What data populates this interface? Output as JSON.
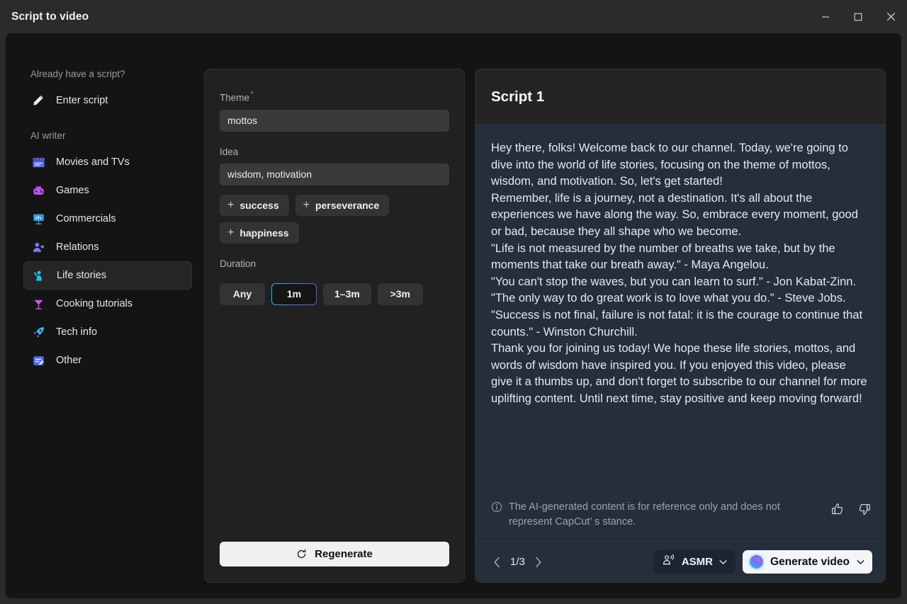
{
  "window": {
    "title": "Script to video",
    "controls": {
      "minimize": "minimize-button",
      "maximize": "maximize-button",
      "close": "close-button"
    }
  },
  "sidebar": {
    "groups": [
      {
        "label": "Already have a script?",
        "items": [
          {
            "label": "Enter script",
            "icon": "pencil-icon",
            "selected": false
          }
        ]
      },
      {
        "label": "AI writer",
        "items": [
          {
            "label": "Movies and TVs",
            "icon": "clapperboard-icon",
            "selected": false
          },
          {
            "label": "Games",
            "icon": "gamepad-icon",
            "selected": false
          },
          {
            "label": "Commercials",
            "icon": "presentation-chart-icon",
            "selected": false
          },
          {
            "label": "Relations",
            "icon": "person-heart-icon",
            "selected": false
          },
          {
            "label": "Life stories",
            "icon": "person-waving-icon",
            "selected": true
          },
          {
            "label": "Cooking tutorials",
            "icon": "cocktail-glass-icon",
            "selected": false
          },
          {
            "label": "Tech info",
            "icon": "rocket-icon",
            "selected": false
          },
          {
            "label": "Other",
            "icon": "note-edit-icon",
            "selected": false
          }
        ]
      }
    ]
  },
  "form": {
    "theme_label": "Theme",
    "theme_required_marker": "*",
    "theme_value": "mottos",
    "theme_placeholder": "mottos",
    "idea_label": "Idea",
    "idea_value": "wisdom, motivation",
    "idea_placeholder": "wisdom, motivation",
    "suggestion_chips": [
      {
        "plus": "+",
        "label": "success"
      },
      {
        "plus": "+",
        "label": "perseverance"
      },
      {
        "plus": "+",
        "label": "happiness"
      }
    ],
    "duration_label": "Duration",
    "duration_options": [
      {
        "label": "Any",
        "active": false
      },
      {
        "label": "1m",
        "active": true
      },
      {
        "label": "1–3m",
        "active": false
      },
      {
        "label": ">3m",
        "active": false
      }
    ],
    "regenerate_label": "Regenerate",
    "regenerate_icon": "refresh-icon"
  },
  "script_panel": {
    "title": "Script 1",
    "body": "Hey there, folks! Welcome back to our channel. Today, we're going to dive into the world of life stories, focusing on the theme of mottos, wisdom, and motivation. So, let's get started!\nRemember, life is a journey, not a destination. It's all about the experiences we have along the way. So, embrace every moment, good or bad, because they all shape who we become.\n\"Life is not measured by the number of breaths we take, but by the moments that take our breath away.\" - Maya Angelou.\n\"You can't stop the waves, but you can learn to surf.\" - Jon Kabat-Zinn.\n\"The only way to do great work is to love what you do.\" - Steve Jobs.\n\"Success is not final, failure is not fatal: it is the courage to continue that counts.\" - Winston Churchill.\nThank you for joining us today! We hope these life stories, mottos, and words of wisdom have inspired you. If you enjoyed this video, please give it a thumbs up, and don't forget to subscribe to our channel for more uplifting content. Until next time, stay positive and keep moving forward!",
    "disclaimer": "The AI-generated content is for reference only and does not represent CapCut’ s stance.",
    "disclaimer_icon": "info-circle-icon",
    "thumbs_up_icon": "thumbs-up-icon",
    "thumbs_down_icon": "thumbs-down-icon",
    "pagination": {
      "prev_icon": "chevron-left-icon",
      "label": "1/3",
      "next_icon": "chevron-right-icon"
    },
    "asmr": {
      "icon": "voice-person-icon",
      "label": "ASMR",
      "caret": "chevron-down-icon"
    },
    "generate": {
      "icon": "ai-orb-icon",
      "label": "Generate video",
      "caret": "chevron-down-icon"
    }
  },
  "colors": {
    "app_background": "#141414",
    "titlebar": "#2b2b2b",
    "mid_panel": "#212121",
    "right_panel": "#252e3b",
    "right_header": "#242424",
    "accent_gradient_start": "#17c8e8",
    "accent_gradient_end": "#8b3fe8",
    "required_marker": "#e04e4e",
    "primary_button": "#f3f5f7"
  }
}
